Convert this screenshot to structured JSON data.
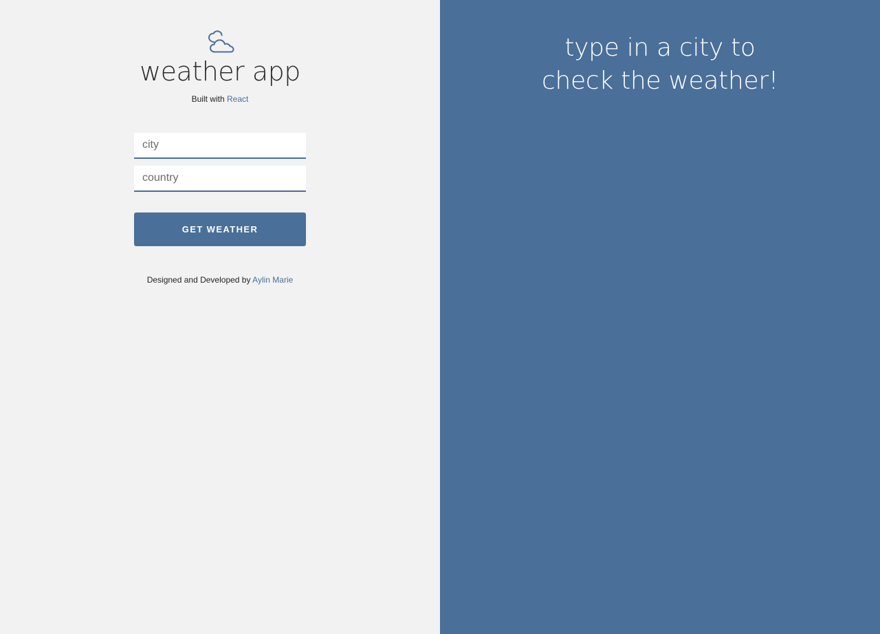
{
  "app": {
    "title": "weather app",
    "logo_icon": "cloud-icon",
    "built_with_prefix": "Built with",
    "built_with_link": "React",
    "accent_color": "#4a6f99",
    "left_bg": "#f2f2f2"
  },
  "form": {
    "city_placeholder": "city",
    "city_value": "",
    "country_placeholder": "country",
    "country_value": "",
    "submit_label": "GET WEATHER"
  },
  "footer": {
    "credit_prefix": "Designed and Developed by",
    "credit_link": "Aylin Marie"
  },
  "result_panel": {
    "prompt_line1": "type in a city to",
    "prompt_line2": "check the weather!"
  }
}
